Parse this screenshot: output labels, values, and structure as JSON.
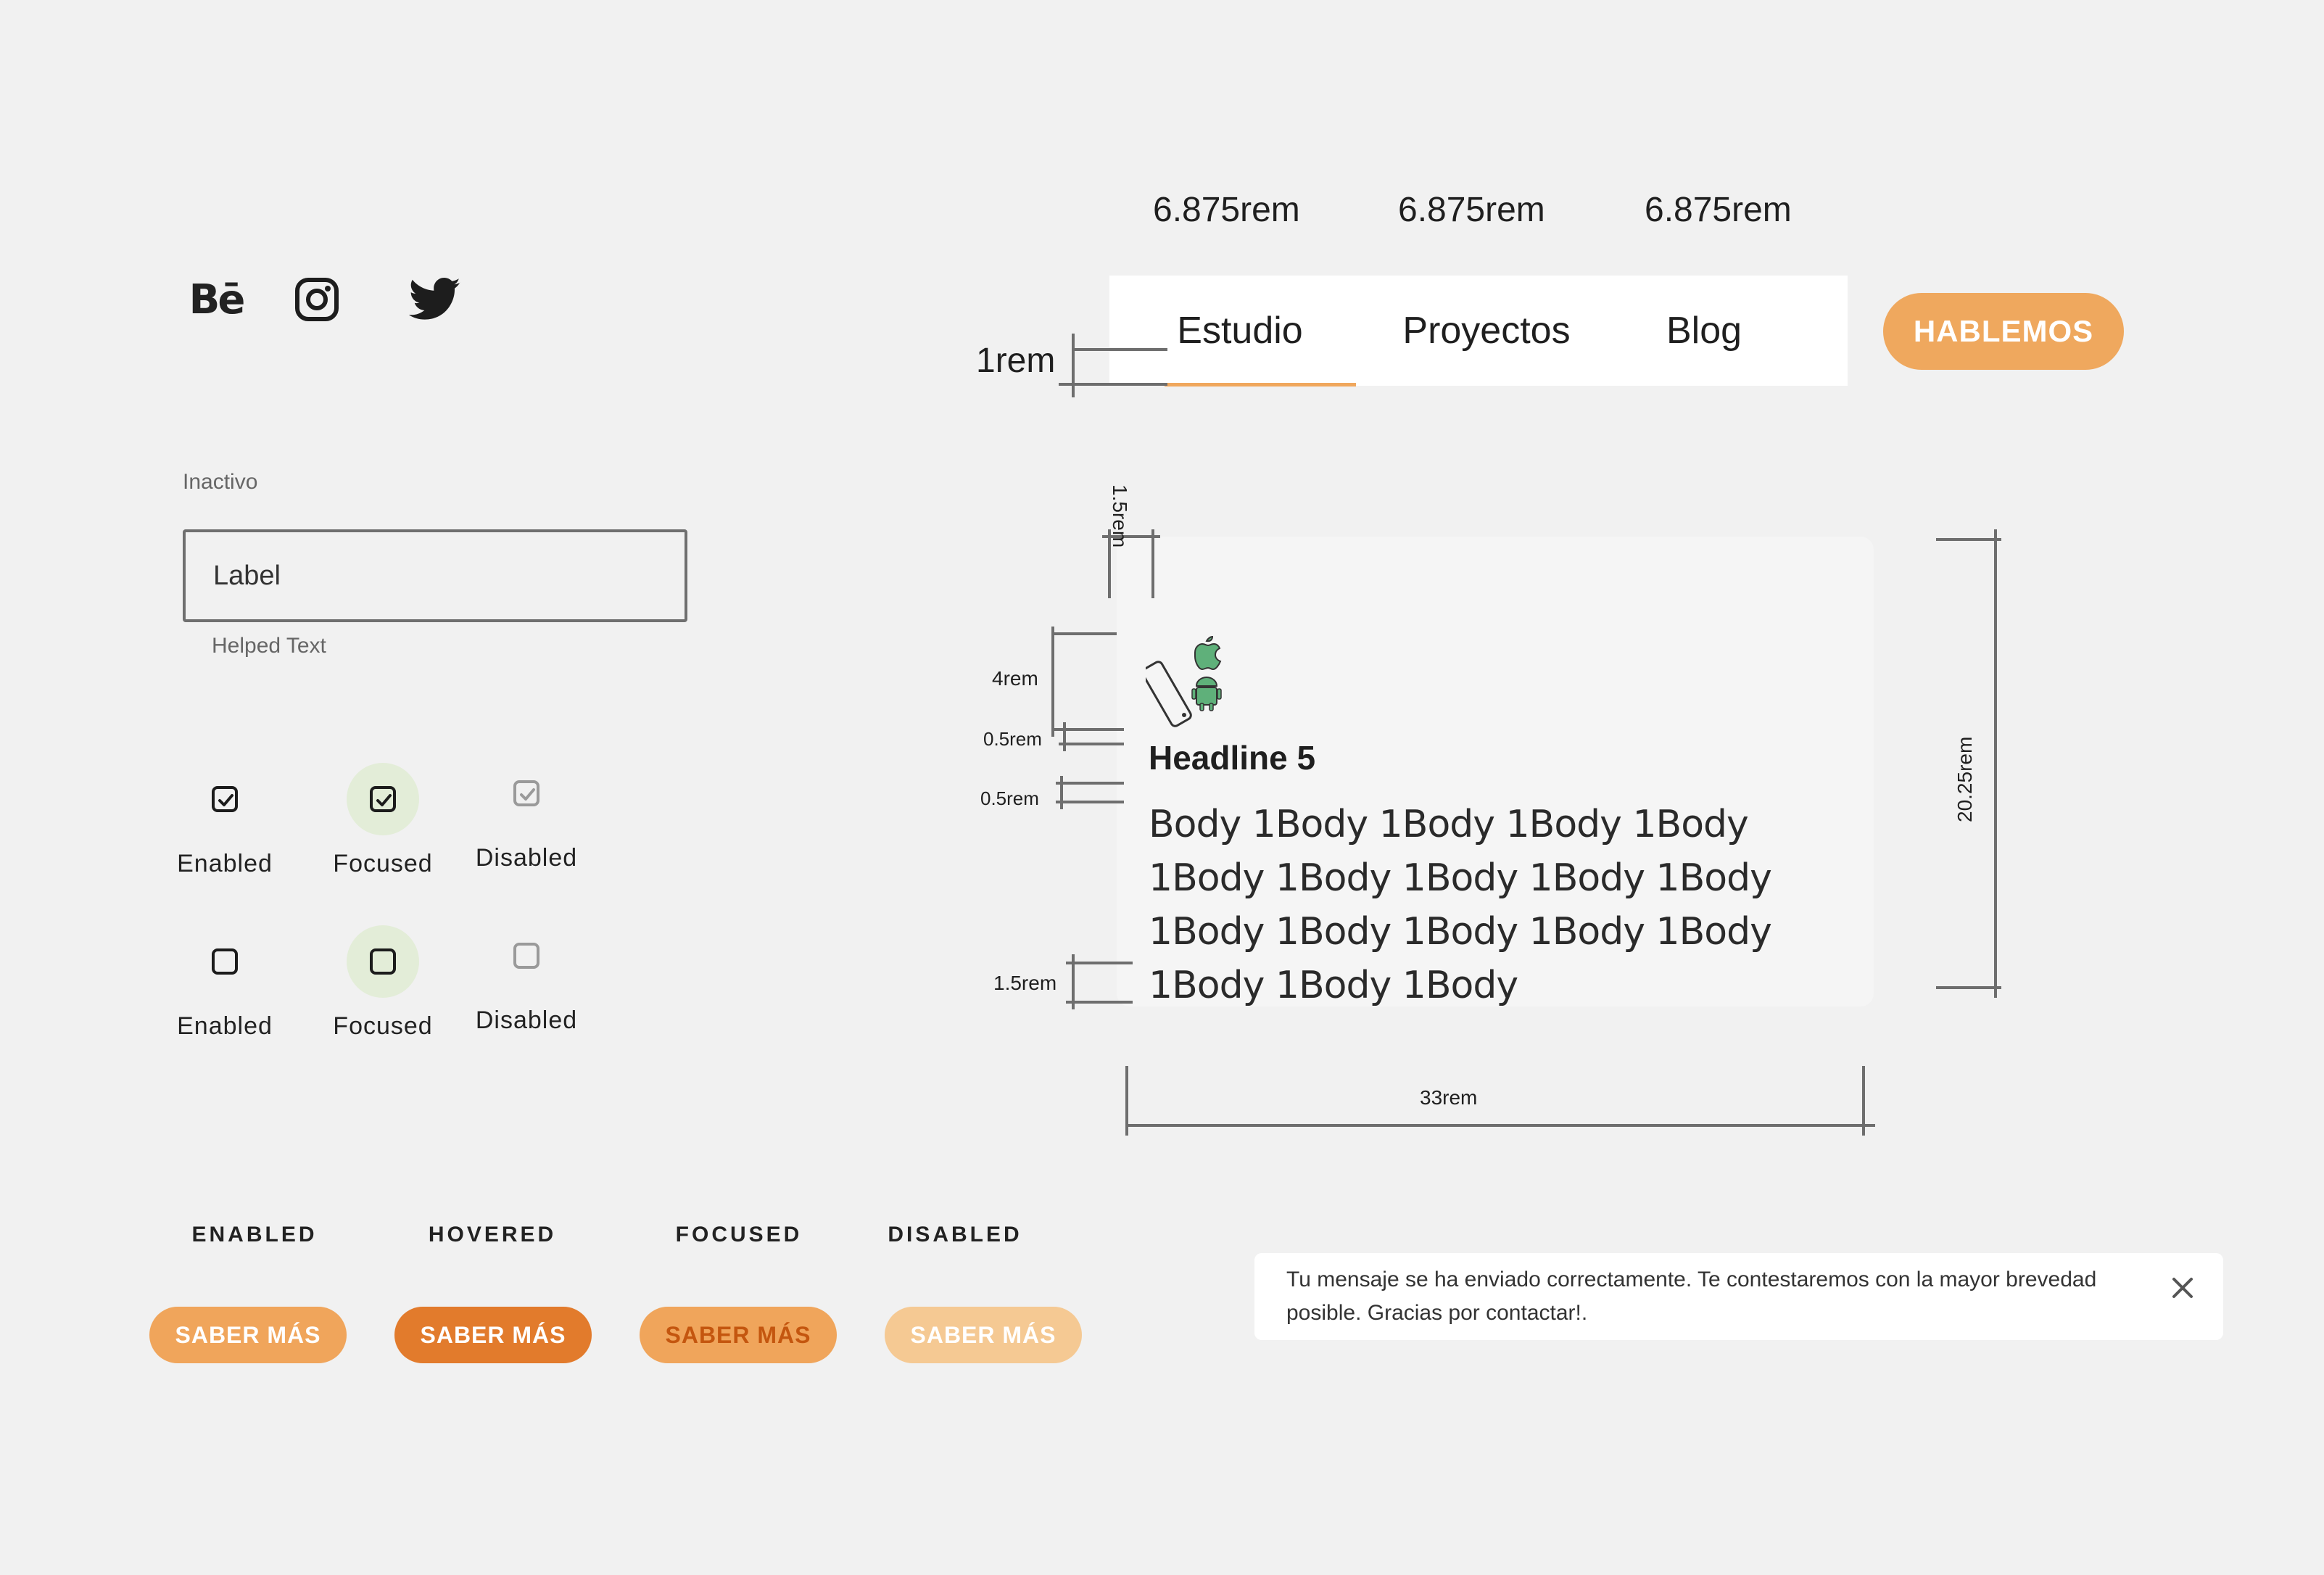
{
  "social": {
    "behance_text": "Bē",
    "icons": [
      "behance-icon",
      "instagram-icon",
      "twitter-icon"
    ]
  },
  "text_field": {
    "state_label": "Inactivo",
    "value": "Label",
    "helper": "Helped Text"
  },
  "checkboxes": {
    "checked_row": [
      {
        "label": "Enabled",
        "state": "enabled",
        "checked": true
      },
      {
        "label": "Focused",
        "state": "focused",
        "checked": true
      },
      {
        "label": "Disabled",
        "state": "disabled",
        "checked": true
      }
    ],
    "unchecked_row": [
      {
        "label": "Enabled",
        "state": "enabled",
        "checked": false
      },
      {
        "label": "Focused",
        "state": "focused",
        "checked": false
      },
      {
        "label": "Disabled",
        "state": "disabled",
        "checked": false
      }
    ]
  },
  "buttons": {
    "states": [
      "ENABLED",
      "HOVERED",
      "FOCUSED",
      "DISABLED"
    ],
    "label": "SABER MÁS",
    "colors": {
      "enabled": "#f0a55b",
      "hovered": "#e27b2c",
      "focused": "#f0a55b",
      "focused_text": "#c4560f",
      "disabled": "#f5c993"
    }
  },
  "nav": {
    "widths": [
      "6.875rem",
      "6.875rem",
      "6.875rem"
    ],
    "items": [
      "Estudio",
      "Proyectos",
      "Blog"
    ],
    "active_index": 0,
    "height_label": "1rem",
    "cta": "HABLEMOS",
    "accent": "#efa85e"
  },
  "card": {
    "headline": "Headline 5",
    "body": "Body 1Body 1Body 1Body 1Body 1Body 1Body 1Body 1Body 1Body 1Body 1Body 1Body 1Body 1Body 1Body 1Body 1Body",
    "dims": {
      "top_padding": "1.5rem",
      "icon_height": "4rem",
      "gap1": "0.5rem",
      "gap2": "0.5rem",
      "bottom_padding": "1.5rem",
      "height": "20.25rem",
      "width": "33rem"
    }
  },
  "toast": {
    "message": "Tu mensaje se ha enviado correctamente. Te contestaremos con la mayor brevedad posible. Gracias por contactar!."
  }
}
